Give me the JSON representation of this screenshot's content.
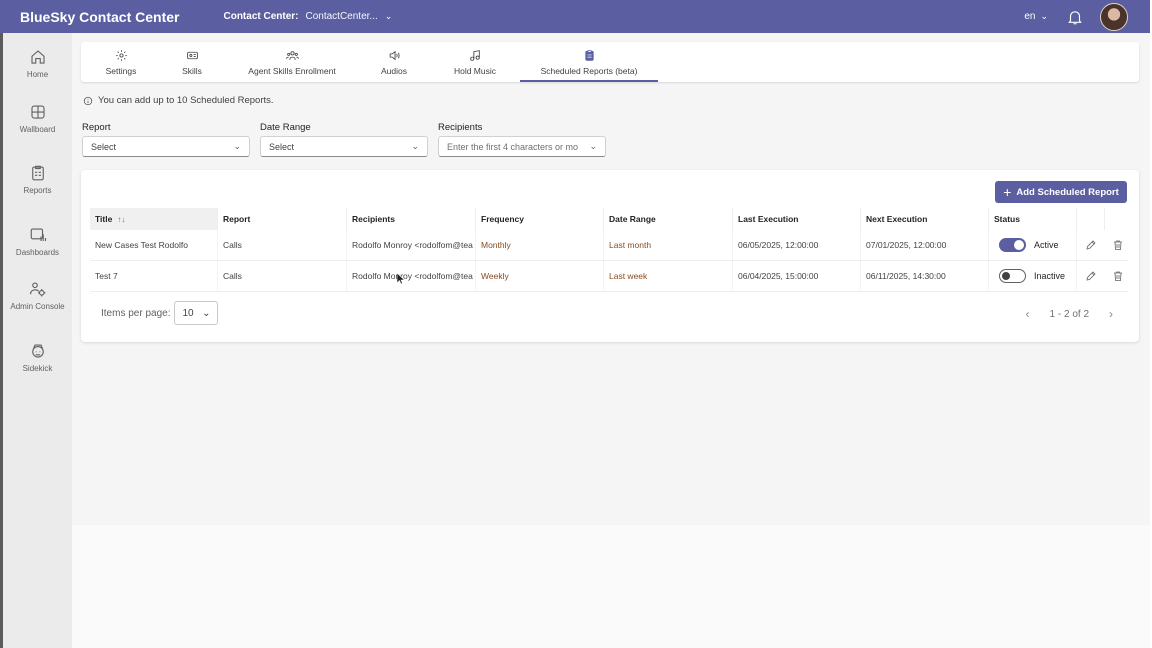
{
  "header": {
    "brand": "BlueSky Contact Center",
    "contact_center_label": "Contact Center:",
    "contact_center_value": "ContactCenter...",
    "language": "en"
  },
  "sidebar": {
    "items": [
      {
        "label": "Home",
        "icon": "home-icon"
      },
      {
        "label": "Wallboard",
        "icon": "wallboard-icon"
      },
      {
        "label": "Reports",
        "icon": "reports-icon"
      },
      {
        "label": "Dashboards",
        "icon": "dashboards-icon"
      },
      {
        "label": "Admin Console",
        "icon": "admin-console-icon"
      },
      {
        "label": "Sidekick",
        "icon": "sidekick-icon"
      }
    ]
  },
  "tabs": [
    {
      "label": "Settings",
      "icon": "gear-icon"
    },
    {
      "label": "Skills",
      "icon": "id-card-icon"
    },
    {
      "label": "Agent Skills Enrollment",
      "icon": "people-group-icon"
    },
    {
      "label": "Audios",
      "icon": "speaker-icon"
    },
    {
      "label": "Hold Music",
      "icon": "music-note-icon"
    },
    {
      "label": "Scheduled Reports (beta)",
      "icon": "clipboard-icon",
      "active": true
    }
  ],
  "info": "You can add up to 10 Scheduled Reports.",
  "filters": {
    "report": {
      "label": "Report",
      "value": "Select"
    },
    "date_range": {
      "label": "Date Range",
      "value": "Select"
    },
    "recipients": {
      "label": "Recipients",
      "placeholder": "Enter the first 4 characters or mo"
    }
  },
  "add_button": "Add Scheduled Report",
  "table": {
    "columns": [
      "Title",
      "Report",
      "Recipients",
      "Frequency",
      "Date Range",
      "Last Execution",
      "Next Execution",
      "Status"
    ],
    "sort_indicator": "↑↓",
    "rows": [
      {
        "title": "New Cases Test Rodolfo",
        "report": "Calls",
        "recipients": "Rodolfo Monroy <rodolfom@tea",
        "frequency": "Monthly",
        "date_range": "Last month",
        "last_execution": "06/05/2025, 12:00:00",
        "next_execution": "07/01/2025, 12:00:00",
        "status": "Active",
        "active": true
      },
      {
        "title": "Test 7",
        "report": "Calls",
        "recipients": "Rodolfo Monroy <rodolfom@tea",
        "frequency": "Weekly",
        "date_range": "Last week",
        "last_execution": "06/04/2025, 15:00:00",
        "next_execution": "06/11/2025, 14:30:00",
        "status": "Inactive",
        "active": false
      }
    ]
  },
  "pagination": {
    "items_per_page_label": "Items per page:",
    "items_per_page": "10",
    "range": "1 - 2 of 2"
  },
  "colors": {
    "brand": "#5b5fa2",
    "accent_text": "#8a4b1e"
  }
}
